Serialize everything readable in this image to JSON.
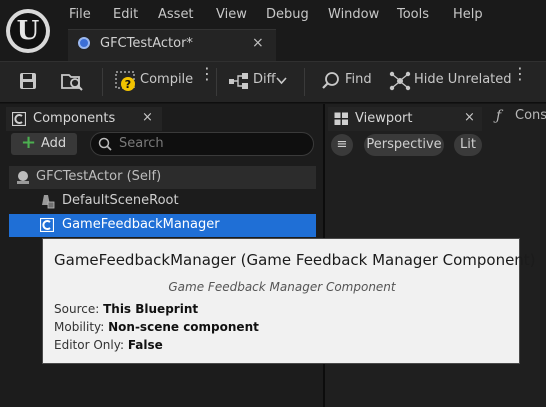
{
  "menu": [
    "File",
    "Edit",
    "Asset",
    "View",
    "Debug",
    "Window",
    "Tools",
    "Help"
  ],
  "document_tab": {
    "label": "GFCTestActor*",
    "close": "×"
  },
  "toolbar": {
    "compile_label": "Compile",
    "diff_label": "Diff",
    "find_label": "Find",
    "hide_unrelated_label": "Hide Unrelated",
    "more_glyph": "⋮"
  },
  "components_panel": {
    "tab_label": "Components",
    "tab_close": "×",
    "add_label": "Add",
    "add_glyph": "+",
    "search_placeholder": "Search",
    "tree": [
      {
        "label": "GFCTestActor (Self)",
        "icon": "actor-icon",
        "selected": false
      },
      {
        "label": "DefaultSceneRoot",
        "icon": "scene-root-icon",
        "selected": false
      },
      {
        "label": "GameFeedbackManager",
        "icon": "component-icon",
        "selected": true
      }
    ]
  },
  "viewport_panel": {
    "tab_label": "Viewport",
    "tab_close": "×",
    "construction_tab_label": "Const",
    "perspective_label": "Perspective",
    "lit_label": "Lit",
    "menu_glyph": "≡"
  },
  "tooltip": {
    "title": "GameFeedbackManager (Game Feedback Manager Component)",
    "subtitle": "Game Feedback Manager Component",
    "rows": [
      {
        "key": "Source:",
        "value": "This Blueprint"
      },
      {
        "key": "Mobility:",
        "value": "Non-scene component"
      },
      {
        "key": "Editor Only:",
        "value": "False"
      }
    ]
  },
  "colors": {
    "selection": "#1f6fd6",
    "accent_warning": "#f2c300",
    "add_plus": "#4caf50"
  }
}
